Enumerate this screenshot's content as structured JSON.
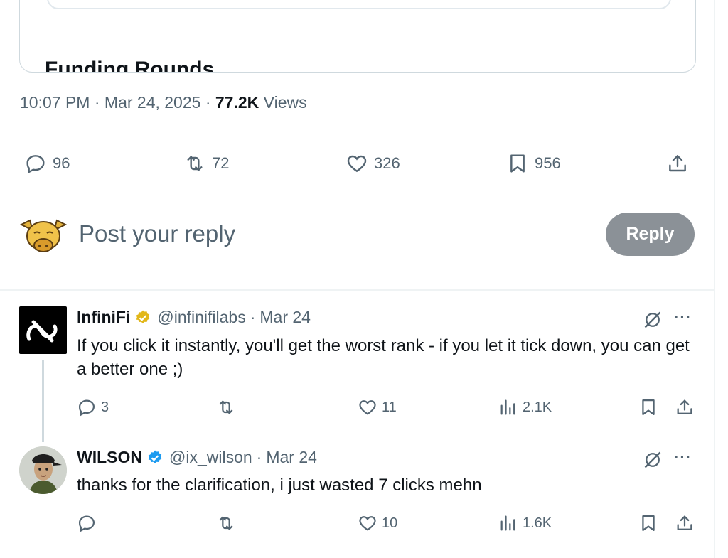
{
  "quote_card": {
    "title": "Funding Rounds"
  },
  "post": {
    "time": "10:07 PM",
    "date": "Mar 24, 2025",
    "views_count": "77.2K",
    "views_label": "Views",
    "replies": "96",
    "reposts": "72",
    "likes": "326",
    "bookmarks": "956"
  },
  "composer": {
    "placeholder": "Post your reply",
    "button": "Reply"
  },
  "replies": [
    {
      "name": "InfiniFi",
      "handle": "@infinifilabs",
      "date": "Mar 24",
      "text": "If you click it instantly, you'll get the worst rank - if you let it tick down, you can get a better one ;)",
      "replies": "3",
      "reposts": "",
      "likes": "11",
      "views": "2.1K",
      "badge_color": "#e2b719"
    },
    {
      "name": "WILSON",
      "handle": "@ix_wilson",
      "date": "Mar 24",
      "text": "thanks for the clarification, i just wasted 7 clicks mehn",
      "replies": "",
      "reposts": "",
      "likes": "10",
      "views": "1.6K",
      "badge_color": "#1d9bf0"
    }
  ],
  "separator": "·",
  "more_glyph": "···",
  "colors": {
    "secondary_text": "#536471",
    "primary_text": "#0f1419",
    "reply_button": "#8b9197"
  }
}
